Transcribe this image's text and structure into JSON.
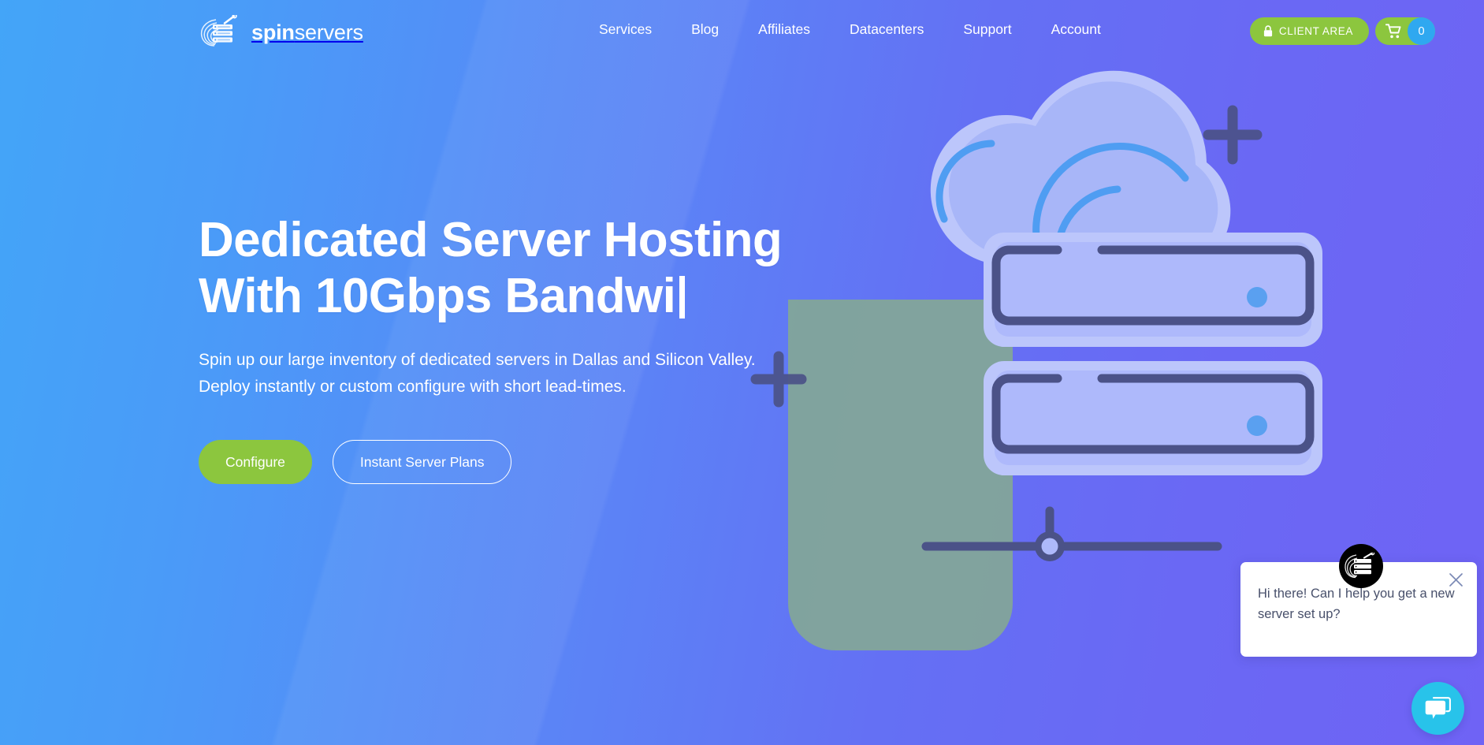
{
  "brand": {
    "name_bold": "spin",
    "name_light": "servers",
    "logo_icon": "server-stack-swoosh-logo"
  },
  "header": {
    "nav": [
      {
        "label": "Services"
      },
      {
        "label": "Blog"
      },
      {
        "label": "Affiliates"
      },
      {
        "label": "Datacenters"
      },
      {
        "label": "Support"
      },
      {
        "label": "Account"
      }
    ],
    "client_area": {
      "label": "CLIENT AREA",
      "icon": "lock-icon",
      "color": "#8cc63e"
    },
    "cart": {
      "icon": "shopping-cart-icon",
      "count": "0",
      "badge_color": "#2fa8f0"
    }
  },
  "hero": {
    "title_line1": "Dedicated Server Hosting",
    "title_line2": "With 10Gbps Bandwi",
    "typing_cursor": "|",
    "subtitle_line1": "Spin up our large inventory of dedicated servers in Dallas and Silicon Valley.",
    "subtitle_line2": "Deploy instantly or custom configure with short lead-times.",
    "buttons": [
      {
        "label": "Configure",
        "style": "primary"
      },
      {
        "label": "Instant Server Plans",
        "style": "outline"
      }
    ]
  },
  "illustration": {
    "name": "cloud-server-rack-illustration",
    "elements": [
      "cloud",
      "server-box-top",
      "server-box-bottom",
      "status-dot",
      "connector-node",
      "plus-sparkle-large",
      "plus-sparkle-small",
      "green-panel"
    ],
    "colors": {
      "cloud_fill": "#a8b6f8",
      "cloud_outline": "#bcc6fb",
      "arc_blue": "#4f9df2",
      "stroke_navy": "#4b5288",
      "box_fill": "#aeb9fb",
      "dot_blue": "#5aa0f0",
      "panel_green": "#83a796"
    }
  },
  "chat": {
    "avatar_icon": "spinservers-avatar-icon",
    "message": "Hi there! Can I help you get a new server set up?",
    "close_icon": "close-icon",
    "launcher_icon": "chat-bubbles-icon",
    "launcher_color": "#28c3ea"
  },
  "theme": {
    "bg_gradient_start": "#43a5f8",
    "bg_gradient_end": "#6f63f5",
    "accent_green": "#8cc63e",
    "accent_blue": "#2fa8f0"
  }
}
